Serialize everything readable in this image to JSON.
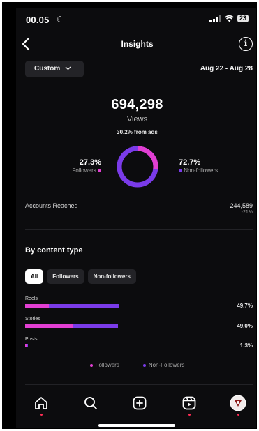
{
  "status_bar": {
    "time": "00.05",
    "battery": "23"
  },
  "header": {
    "title": "Insights"
  },
  "filter": {
    "label": "Custom",
    "date_range": "Aug 22 - Aug 28"
  },
  "views": {
    "value": "694,298",
    "label": "Views",
    "ads_note": "30.2% from ads"
  },
  "audience": {
    "followers_pct": "27.3%",
    "followers_label": "Followers",
    "followers_fraction": 0.273,
    "nonfollowers_pct": "72.7%",
    "nonfollowers_label": "Non-followers"
  },
  "accounts_reached": {
    "label": "Accounts Reached",
    "value": "244,589",
    "change": "-21%"
  },
  "content_type": {
    "title": "By content type",
    "tabs": [
      "All",
      "Followers",
      "Non-followers"
    ],
    "active_tab": "All",
    "rows": [
      {
        "label": "Reels",
        "pct": "49.7%",
        "value": 49.7,
        "followers_share": 0.25
      },
      {
        "label": "Stories",
        "pct": "49.0%",
        "value": 49.0,
        "followers_share": 0.51
      },
      {
        "label": "Posts",
        "pct": "1.3%",
        "value": 1.3,
        "followers_share": 0.5
      }
    ],
    "legend": {
      "followers": "Followers",
      "nonfollowers": "Non-Followers"
    }
  },
  "colors": {
    "followers": "#e23fd2",
    "nonfollowers": "#7a3be8",
    "background": "#0c0c0e"
  },
  "nav": {
    "icons": [
      "home-icon",
      "search-icon",
      "create-icon",
      "reels-icon",
      "profile-avatar"
    ]
  }
}
